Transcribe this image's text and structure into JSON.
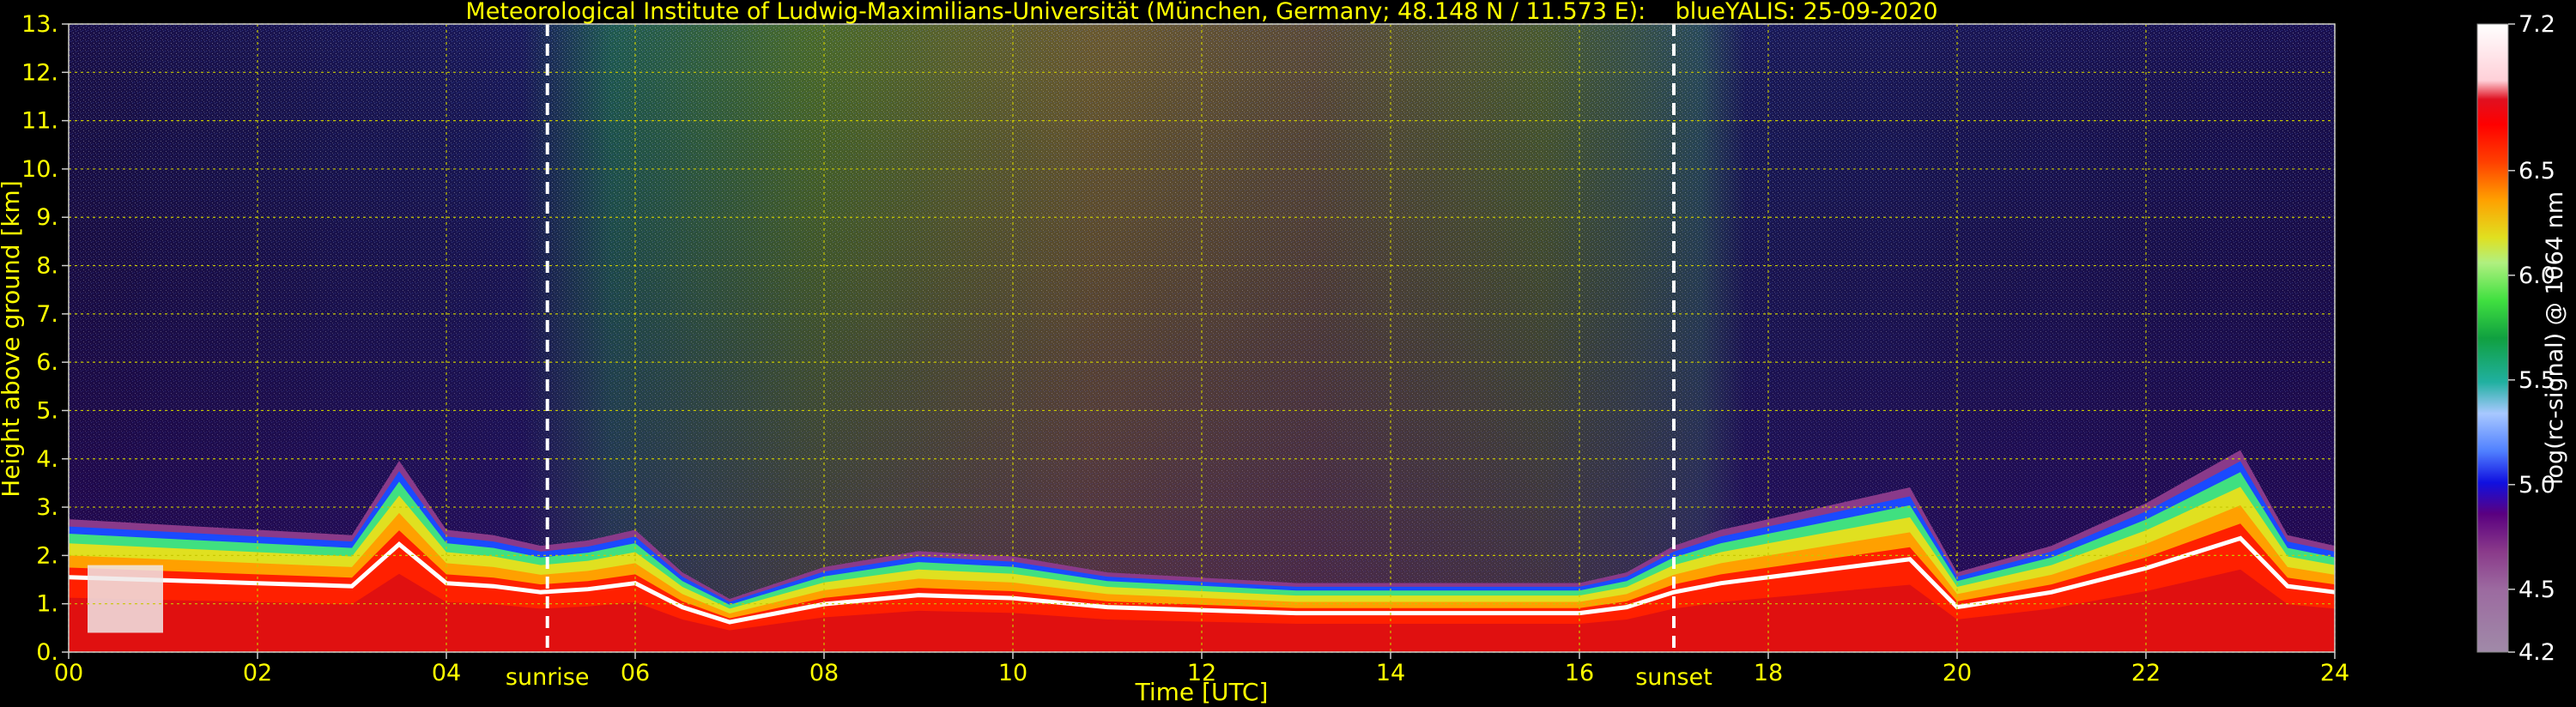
{
  "chart_data": {
    "type": "heatmap",
    "title": "Meteorological Institute of Ludwig-Maximilians-Universität (München, Germany; 48.148 N / 11.573 E):    blueYALIS: 25-09-2020",
    "xlabel": "Time [UTC]",
    "ylabel": "Height above ground [km]",
    "xlim": [
      0,
      24
    ],
    "ylim": [
      0,
      13
    ],
    "x_ticks": [
      "00",
      "02",
      "04",
      "06",
      "08",
      "10",
      "12",
      "14",
      "16",
      "18",
      "20",
      "22",
      "24"
    ],
    "y_ticks": [
      "0.",
      "1.",
      "2.",
      "3.",
      "4.",
      "5.",
      "6.",
      "7.",
      "8.",
      "9.",
      "10.",
      "11.",
      "12.",
      "13."
    ],
    "grid": true,
    "colorbar": {
      "label": "log(rc-signal) @ 1064 nm",
      "range": [
        4.2,
        7.2
      ],
      "ticks": [
        "4.2",
        "4.5",
        "5.0",
        "5.5",
        "6.0",
        "6.5",
        "7.2"
      ],
      "colors": [
        "#a08aa8",
        "#9c6aa0",
        "#8a3a8a",
        "#700070",
        "#5a0080",
        "#3a00b0",
        "#1010e0",
        "#2050ff",
        "#5080ff",
        "#80a8ff",
        "#a8c8ff",
        "#60d0c0",
        "#20b0a0",
        "#10a040",
        "#20c030",
        "#40e040",
        "#80f060",
        "#b0f080",
        "#40e0a0",
        "#20d080",
        "#e0e020",
        "#ffd000",
        "#ffa000",
        "#ff7000",
        "#ff4000",
        "#ff0000",
        "#e01020",
        "#ffd0d8",
        "#ffffff"
      ]
    },
    "annotations": [
      {
        "label": "sunrise",
        "x": 5.07
      },
      {
        "label": "sunset",
        "x": 17.0
      }
    ],
    "signal_profile": {
      "time_hours": [
        0,
        1,
        2,
        3,
        3.5,
        4,
        4.5,
        5,
        5.5,
        6,
        6.5,
        7,
        7.5,
        8,
        9,
        10,
        11,
        12,
        13,
        14,
        15,
        16,
        16.5,
        17,
        17.5,
        18,
        18.5,
        19,
        19.5,
        20,
        21,
        22,
        23,
        23.5,
        24
      ],
      "boundary_layer_top_km": [
        2.5,
        2.4,
        2.3,
        2.2,
        3.6,
        2.3,
        2.2,
        2.0,
        2.1,
        2.3,
        1.5,
        1.0,
        1.3,
        1.6,
        1.9,
        1.8,
        1.5,
        1.4,
        1.3,
        1.3,
        1.3,
        1.3,
        1.5,
        2.0,
        2.3,
        2.5,
        2.7,
        2.9,
        3.1,
        1.5,
        2.0,
        2.8,
        3.8,
        2.2,
        2.0
      ]
    }
  }
}
